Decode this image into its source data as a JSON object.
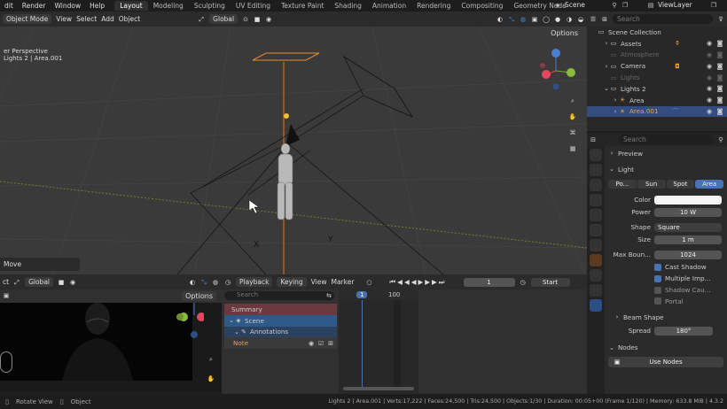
{
  "menu": [
    "dit",
    "Render",
    "Window",
    "Help"
  ],
  "workspaces": [
    "Layout",
    "Modeling",
    "Sculpting",
    "UV Editing",
    "Texture Paint",
    "Shading",
    "Animation",
    "Rendering",
    "Compositing",
    "Geometry Node"
  ],
  "active_workspace": "Layout",
  "scene_name": "Scene",
  "view_layer": "ViewLayer",
  "viewport_header": {
    "mode": "Object Mode",
    "menus": [
      "View",
      "Select",
      "Add",
      "Object"
    ],
    "orientation": "Global",
    "options": "Options"
  },
  "viewport": {
    "line1": "er Perspective",
    "line2": "Lights 2 | Area.001"
  },
  "last_op": "Move",
  "outliner": {
    "search_placeholder": "Search",
    "root": "Scene Collection",
    "items": [
      {
        "label": "Assets",
        "dim": false
      },
      {
        "label": "Atmosphere",
        "dim": true
      },
      {
        "label": "Camera",
        "dim": false
      },
      {
        "label": "Lights",
        "dim": true
      },
      {
        "label": "Lights 2",
        "dim": false
      },
      {
        "label": "Area",
        "dim": false
      },
      {
        "label": "Area.001",
        "dim": false,
        "selected": true
      }
    ]
  },
  "properties": {
    "search_placeholder": "Search",
    "preview": "Preview",
    "light": "Light",
    "light_types": [
      "Po...",
      "Sun",
      "Spot",
      "Area"
    ],
    "active_type": "Area",
    "color_label": "Color",
    "power_label": "Power",
    "power_value": "10 W",
    "shape_label": "Shape",
    "shape_value": "Square",
    "size_label": "Size",
    "size_value": "1 m",
    "max_bounce_label": "Max Boun...",
    "max_bounce_value": "1024",
    "checks": [
      {
        "label": "Cast Shadow",
        "on": true
      },
      {
        "label": "Multiple Imp...",
        "on": true
      },
      {
        "label": "Shadow Cau...",
        "on": false
      },
      {
        "label": "Portal",
        "on": false
      }
    ],
    "beam_shape": "Beam Shape",
    "spread_label": "Spread",
    "spread_value": "180°",
    "nodes": "Nodes",
    "use_nodes": "Use Nodes"
  },
  "small_vp_header": {
    "left": "ct",
    "orientation": "Global",
    "options": "Options"
  },
  "timeline_header": {
    "menus": [
      "Playback",
      "Keying",
      "View",
      "Marker"
    ],
    "frame": "1",
    "start_label": "Start"
  },
  "dopesheet": {
    "search_placeholder": "Search",
    "rows": [
      "Summary",
      "Scene",
      "Annotations",
      "Note"
    ],
    "frame_marker": "1",
    "frame_100": "100"
  },
  "status": {
    "left1": "Rotate View",
    "left2": "Object",
    "stats": "Lights 2 | Area.001 | Verts:17,222 | Faces:24,500 | Tris:24,500 | Objects:1/30 | Duration: 00:05+00 (Frame 1/120) | Memory: 633.8 MiB | 4.3.2"
  }
}
